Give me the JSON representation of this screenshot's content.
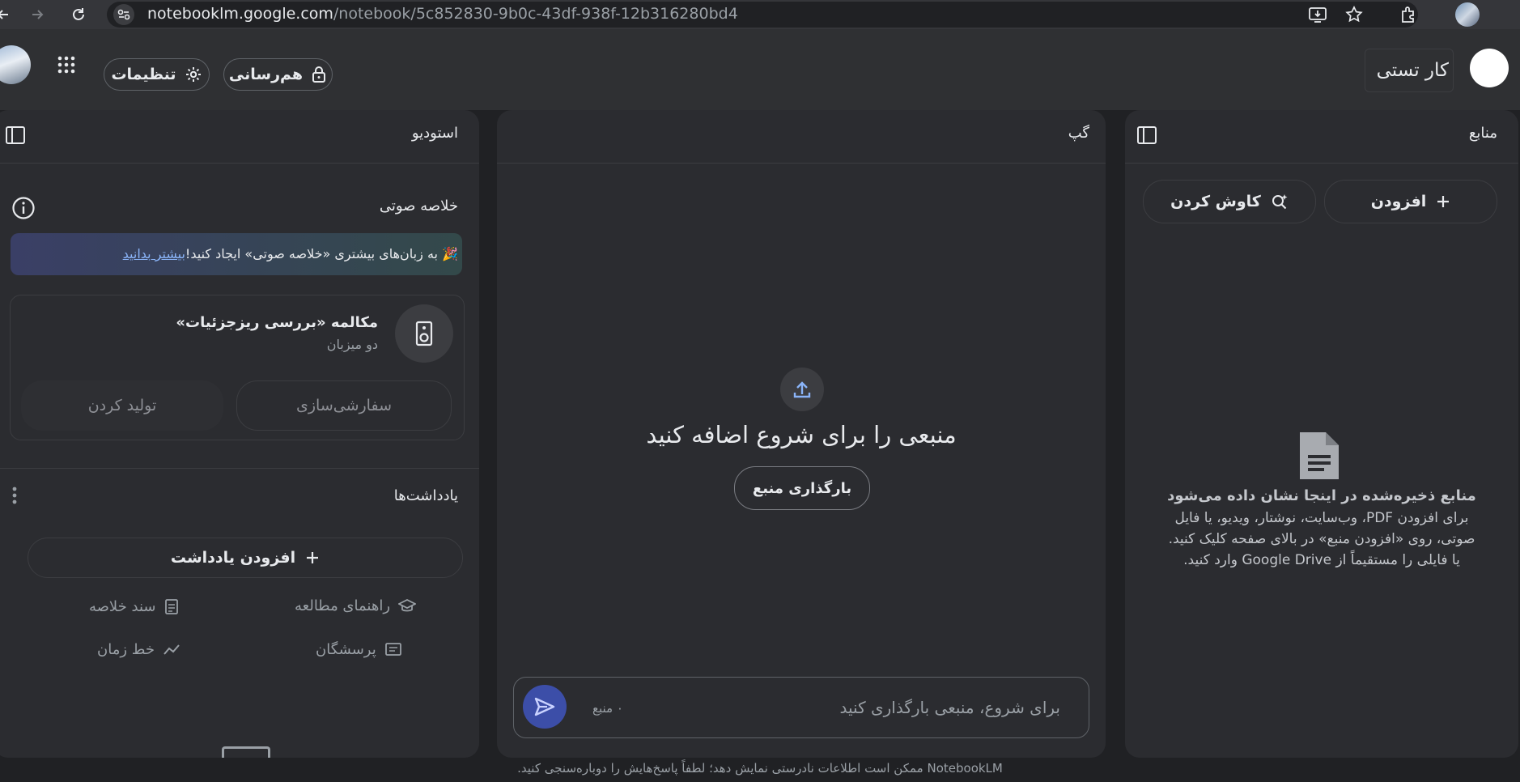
{
  "browser": {
    "url_host": "notebooklm.google.com",
    "url_path": "/notebook/5c852830-9b0c-43df-938f-12b316280bd4"
  },
  "header": {
    "notebook_title": "کار تستی",
    "share_label": "هم‌رسانی",
    "settings_label": "تنظیمات"
  },
  "sources": {
    "title": "منابع",
    "add_label": "افزودن",
    "discover_label": "کاوش کردن",
    "empty_title": "منابع ذخیره‌شده در اینجا نشان داده می‌شود",
    "empty_line1": "برای افزودن PDF، وب‌سایت، نوشتار، ویدیو، یا فایل",
    "empty_line2": "صوتی، روی «افزودن منبع» در بالای صفحه کلیک کنید.",
    "empty_line3": "یا فایلی را مستقیماً از Google Drive وارد کنید."
  },
  "chat": {
    "title": "گپ",
    "empty_heading": "منبعی را برای شروع اضافه کنید",
    "upload_label": "بارگذاری منبع",
    "input_placeholder": "برای شروع، منبعی بارگذاری کنید",
    "source_count": "۰ منبع"
  },
  "studio": {
    "title": "استودیو",
    "audio_title": "خلاصه صوتی",
    "banner_emoji": "🎉",
    "banner_text": "به زبان‌های بیشتری «خلاصه صوتی» ایجاد کنید!",
    "banner_link": "بیشتر بدانید",
    "deep_dive_title": "مکالمه «بررسی ریزجزئیات»",
    "deep_dive_sub": "دو میزبان",
    "customize_label": "سفارشی‌سازی",
    "generate_label": "تولید کردن",
    "notes_title": "یادداشت‌ها",
    "add_note_label": "افزودن یادداشت",
    "study_guide": "راهنمای مطالعه",
    "briefing_doc": "سند خلاصه",
    "faq": "پرسشگان",
    "timeline": "خط زمان"
  },
  "footer": {
    "disclaimer": "NotebookLM ممکن است اطلاعات نادرستی نمایش دهد؛ لطفاً پاسخ‌هایش را دوباره‌سنجی کنید."
  },
  "colors": {
    "background": "#202124",
    "panel": "#2b2c30",
    "accent": "#8ab4f8",
    "send_button": "#3c4ea8",
    "link": "#8ab4f8"
  }
}
